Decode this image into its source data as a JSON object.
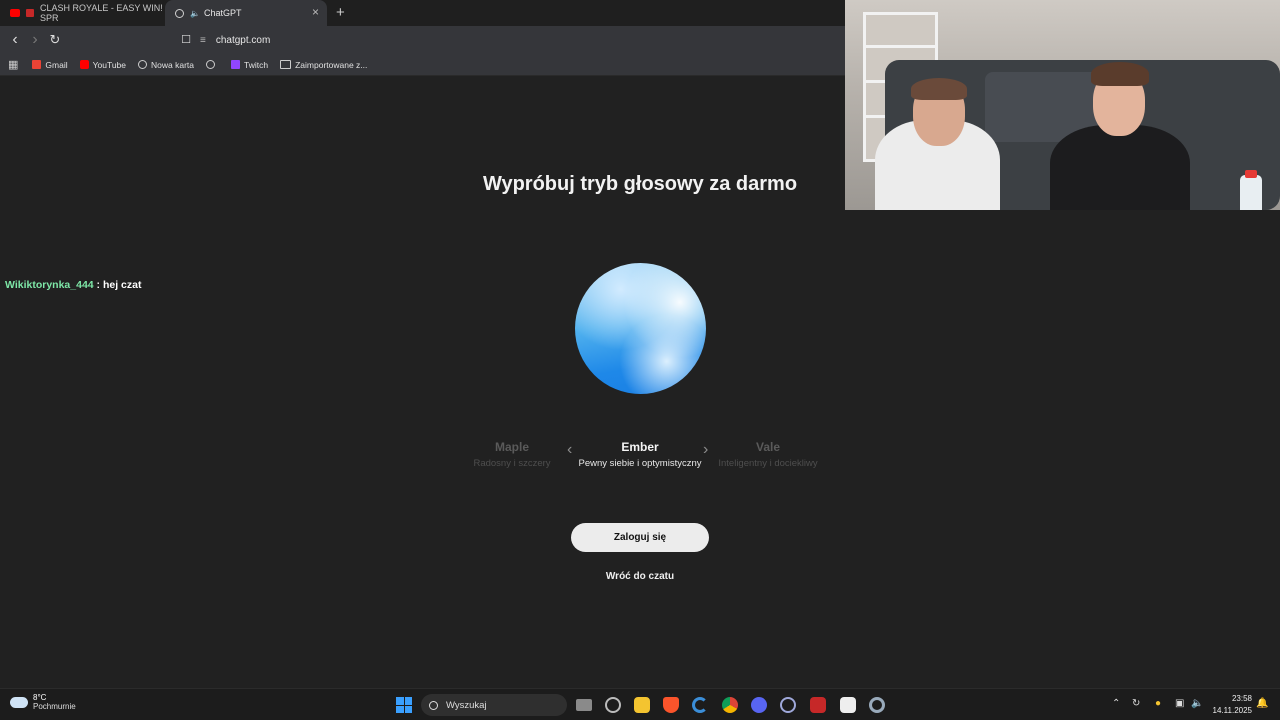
{
  "browser": {
    "tabs": [
      {
        "label": "CLASH ROYALE - EASY WIN! SPR",
        "favicon": "youtube-icon",
        "active": false
      },
      {
        "label": "ChatGPT",
        "favicon": "chatgpt-icon",
        "active": true
      }
    ],
    "url": "chatgpt.com",
    "bookmarks": [
      {
        "label": "Gmail",
        "icon": "gmail-icon"
      },
      {
        "label": "YouTube",
        "icon": "youtube-icon"
      },
      {
        "label": "Nowa karta",
        "icon": "globe-icon"
      },
      {
        "label": "",
        "icon": "globe-icon"
      },
      {
        "label": "Twitch",
        "icon": "twitch-icon"
      },
      {
        "label": "Zaimportowane z...",
        "icon": "folder-icon"
      }
    ]
  },
  "page": {
    "headline": "Wypróbuj tryb głosowy za darmo",
    "voices": [
      {
        "name": "Maple",
        "desc": "Radosny i szczery"
      },
      {
        "name": "Ember",
        "desc": "Pewny siebie i optymistyczny"
      },
      {
        "name": "Vale",
        "desc": "Inteligentny i dociekliwy"
      }
    ],
    "selected_voice": "Ember",
    "login_label": "Zaloguj się",
    "back_label": "Wróć do czatu"
  },
  "chat_overlay": {
    "user": "Wikiktorynka_444",
    "separator": " : ",
    "message": "hej czat"
  },
  "taskbar": {
    "weather_temp": "8°C",
    "weather_desc": "Pochmurnie",
    "search_placeholder": "Wyszukaj",
    "time": "23:58",
    "date": "14.11.2025"
  },
  "colors": {
    "background": "#212121",
    "orb_blue": "#1e88e8",
    "chat_user": "#7ee8a8",
    "login_button": "#ececec"
  }
}
